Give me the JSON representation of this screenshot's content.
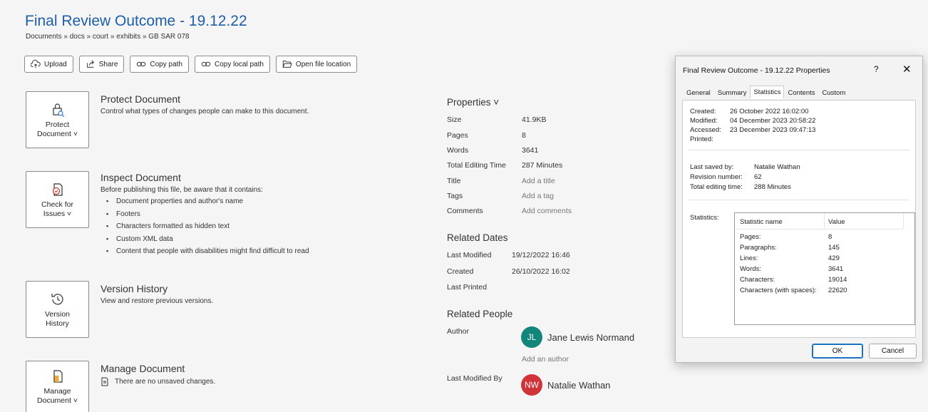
{
  "header": {
    "title": "Final Review Outcome - 19.12.22",
    "breadcrumb": "Documents » docs » court » exhibits » GB SAR 078"
  },
  "toolbar": {
    "upload": "Upload",
    "share": "Share",
    "copy_path": "Copy path",
    "copy_local_path": "Copy local path",
    "open_file_location": "Open file location"
  },
  "sections": {
    "protect": {
      "tile_line1": "Protect",
      "tile_line2": "Document ˅",
      "heading": "Protect Document",
      "desc": "Control what types of changes people can make to this document."
    },
    "inspect": {
      "tile_line1": "Check for",
      "tile_line2": "Issues ˅",
      "heading": "Inspect Document",
      "desc": "Before publishing this file, be aware that it contains:",
      "items": [
        "Document properties and author's name",
        "Footers",
        "Characters formatted as hidden text",
        "Custom XML data",
        "Content that people with disabilities might find difficult to read"
      ]
    },
    "version": {
      "tile_line1": "Version",
      "tile_line2": "History",
      "heading": "Version History",
      "desc": "View and restore previous versions."
    },
    "manage": {
      "tile_line1": "Manage",
      "tile_line2": "Document ˅",
      "heading": "Manage Document",
      "desc": "There are no unsaved changes."
    }
  },
  "properties": {
    "heading": "Properties ˅",
    "rows": [
      {
        "label": "Size",
        "value": "41.9KB"
      },
      {
        "label": "Pages",
        "value": "8"
      },
      {
        "label": "Words",
        "value": "3641"
      },
      {
        "label": "Total Editing Time",
        "value": "287 Minutes"
      },
      {
        "label": "Title",
        "value": "Add a title"
      },
      {
        "label": "Tags",
        "value": "Add a tag"
      },
      {
        "label": "Comments",
        "value": "Add comments"
      }
    ]
  },
  "related_dates": {
    "heading": "Related Dates",
    "rows": [
      {
        "label": "Last Modified",
        "value": "19/12/2022 16:46"
      },
      {
        "label": "Created",
        "value": "26/10/2022 16:02"
      },
      {
        "label": "Last Printed",
        "value": ""
      }
    ]
  },
  "related_people": {
    "heading": "Related People",
    "author_label": "Author",
    "author_initials": "JL",
    "author_name": "Jane Lewis Normand",
    "author_color": "#13857a",
    "add_author": "Add an author",
    "last_modified_label": "Last Modified By",
    "modifier_initials": "NW",
    "modifier_name": "Natalie Wathan",
    "modifier_color": "#d13438"
  },
  "dialog": {
    "title": "Final Review Outcome - 19.12.22 Properties",
    "help": "?",
    "close": "✕",
    "tabs": [
      "General",
      "Summary",
      "Statistics",
      "Contents",
      "Custom"
    ],
    "active_tab": "Statistics",
    "dates": [
      {
        "label": "Created:",
        "value": "26 October 2022 16:02:00"
      },
      {
        "label": "Modified:",
        "value": "04 December 2023 20:58:22"
      },
      {
        "label": "Accessed:",
        "value": "23 December 2023 09:47:13"
      },
      {
        "label": "Printed:",
        "value": ""
      }
    ],
    "last_saved_by_label": "Last saved by:",
    "last_saved_by": "Natalie Wathan",
    "revision_label": "Revision number:",
    "revision": "62",
    "editing_time_label": "Total editing time:",
    "editing_time": "288 Minutes",
    "statistics_label": "Statistics:",
    "stat_header_name": "Statistic name",
    "stat_header_value": "Value",
    "stats": [
      {
        "name": "Pages:",
        "value": "8"
      },
      {
        "name": "Paragraphs:",
        "value": "145"
      },
      {
        "name": "Lines:",
        "value": "429"
      },
      {
        "name": "Words:",
        "value": "3641"
      },
      {
        "name": "Characters:",
        "value": "19014"
      },
      {
        "name": "Characters (with spaces):",
        "value": "22620"
      }
    ],
    "ok": "OK",
    "cancel": "Cancel"
  }
}
